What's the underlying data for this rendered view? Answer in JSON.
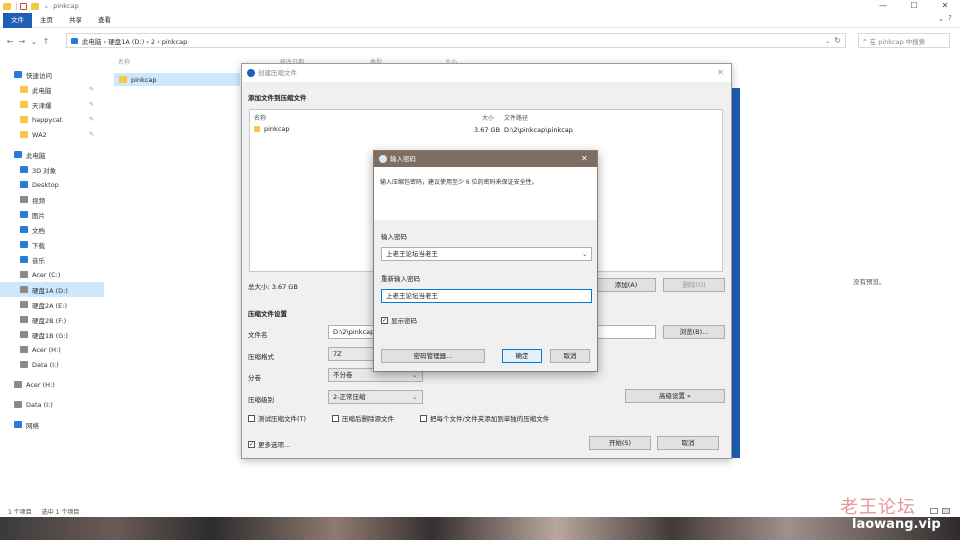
{
  "titlebar": {
    "path": "pinkcap",
    "controls": {
      "minimize": "—",
      "maximize": "☐",
      "close": "✕"
    },
    "help": "?"
  },
  "ribbon": {
    "tabs": [
      "文件",
      "主页",
      "共享",
      "查看"
    ]
  },
  "address": {
    "back": "←",
    "forward": "→",
    "recent": "⌄",
    "up": "↑",
    "crumbs": "此电脑  ›  硬盘1A (D:)  ›  2  ›  pinkcap",
    "dropdown": "⌄",
    "refresh": "↻",
    "search_placeholder": "在 pinkcap 中搜索"
  },
  "sidebar": {
    "items": [
      {
        "label": "快速访问",
        "icon": "star-icon",
        "pinned": false
      },
      {
        "label": "此电脑",
        "icon": "folder-icon",
        "pinned": true
      },
      {
        "label": "天津爆",
        "icon": "folder-icon",
        "pinned": true
      },
      {
        "label": "happycat",
        "icon": "folder-icon",
        "pinned": true
      },
      {
        "label": "WA2",
        "icon": "folder-icon",
        "pinned": true
      },
      {
        "label": "此电脑",
        "icon": "computer-icon",
        "pinned": false
      },
      {
        "label": "3D 对象",
        "icon": "cube-icon",
        "pinned": false
      },
      {
        "label": "Desktop",
        "icon": "desktop-icon",
        "pinned": false
      },
      {
        "label": "视频",
        "icon": "video-icon",
        "pinned": false
      },
      {
        "label": "图片",
        "icon": "picture-icon",
        "pinned": false
      },
      {
        "label": "文档",
        "icon": "document-icon",
        "pinned": false
      },
      {
        "label": "下载",
        "icon": "download-icon",
        "pinned": false
      },
      {
        "label": "音乐",
        "icon": "music-icon",
        "pinned": false
      },
      {
        "label": "Acer (C:)",
        "icon": "drive-icon",
        "pinned": false
      },
      {
        "label": "硬盘1A (D:)",
        "icon": "drive-icon",
        "pinned": false,
        "selected": true
      },
      {
        "label": "硬盘2A (E:)",
        "icon": "drive-icon",
        "pinned": false
      },
      {
        "label": "硬盘2B (F:)",
        "icon": "drive-icon",
        "pinned": false
      },
      {
        "label": "硬盘1B (G:)",
        "icon": "drive-icon",
        "pinned": false
      },
      {
        "label": "Acer (H:)",
        "icon": "drive-icon",
        "pinned": false
      },
      {
        "label": "Data (I:)",
        "icon": "drive-icon",
        "pinned": false
      },
      {
        "label": "Acer (H:)",
        "icon": "drive-icon",
        "pinned": false
      },
      {
        "label": "Data (I:)",
        "icon": "drive-icon",
        "pinned": false
      },
      {
        "label": "网络",
        "icon": "network-icon",
        "pinned": false
      }
    ]
  },
  "content": {
    "columns": [
      "名称",
      "修改日期",
      "类型",
      "大小"
    ],
    "row": "pinkcap",
    "empty_preview": "没有预览。"
  },
  "status": {
    "count": "1 个项目",
    "selected": "选中 1 个项目"
  },
  "archive": {
    "title": "创建压缩文件",
    "section_add": "添加文件到压缩文件",
    "list_headers": {
      "name": "名称",
      "size": "大小",
      "path": "文件路径"
    },
    "file": {
      "name": "pinkcap",
      "size": "3.67 GB",
      "path": "D:\\2\\pinkcap\\pinkcap"
    },
    "total": "总大小: 3.67 GB",
    "add_btn": "添加(A)",
    "remove_btn": "删除(D)",
    "settings_title": "压缩文件设置",
    "filename_label": "文件名",
    "filename_value": "D:\\2\\pinkcap",
    "browse_btn": "浏览(B)...",
    "format_label": "压缩格式",
    "format_value": "7Z",
    "split_label": "分卷",
    "split_value": "不分卷",
    "level_label": "压缩级别",
    "level_value": "2-正常压缩",
    "advanced_btn": "高级设置 »",
    "opt_test": "测试压缩文件(T)",
    "opt_delete": "压缩后删除源文件",
    "opt_separate": "把每个文件/文件夹添加到单独的压缩文件",
    "more_options": "更多选项...",
    "start_btn": "开始(S)",
    "cancel_btn": "取消"
  },
  "password": {
    "title": "输入密码",
    "hint": "输入压缩包密码，建议使用至少 6 位的密码来保证安全性。",
    "pw_label": "输入密码",
    "pw_value": "上老王论坛当老王",
    "confirm_label": "重新输入密码",
    "confirm_value": "上老王论坛当老王",
    "show_pw": "显示密码",
    "manager_btn": "密码管理器...",
    "ok_btn": "确定",
    "cancel_btn": "取消"
  },
  "watermark": {
    "cn": "老王论坛",
    "url": "laowang.vip"
  }
}
